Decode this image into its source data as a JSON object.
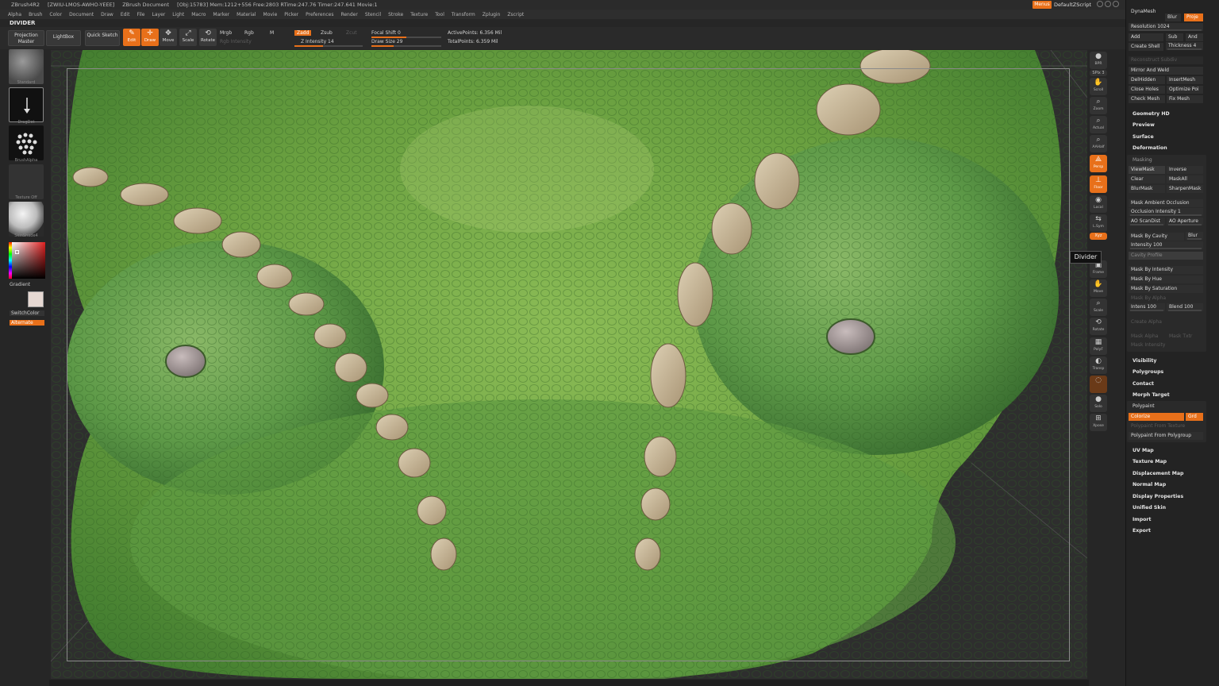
{
  "titlebar": {
    "app": "ZBrush4R2",
    "serial": "[ZWIU-LMOS-AWHO-YEEE]",
    "document": "ZBrush Document",
    "stats": "[Obj:15783] Mem:1212+556 Free:2803 RTime:247.76 Timer:247.641 Movie:1"
  },
  "menubar": {
    "items": [
      "Alpha",
      "Brush",
      "Color",
      "Document",
      "Draw",
      "Edit",
      "File",
      "Layer",
      "Light",
      "Macro",
      "Marker",
      "Material",
      "Movie",
      "Picker",
      "Preferences",
      "Render",
      "Stencil",
      "Stroke",
      "Texture",
      "Tool",
      "Transform",
      "Zplugin",
      "Zscript"
    ],
    "menus_label": "Menus",
    "script_label": "DefaultZScript"
  },
  "palette_title": "DIVIDER",
  "toolbar": {
    "projection_master": "Projection Master",
    "lightbox": "LightBox",
    "quick_sketch": "Quick Sketch",
    "edit": "Edit",
    "draw": "Draw",
    "move": "Move",
    "scale": "Scale",
    "rotate": "Rotate",
    "mrgb": "Mrgb",
    "rgb": "Rgb",
    "m": "M",
    "rgb_intensity": "Rgb Intensity",
    "zadd": "Zadd",
    "zsub": "Zsub",
    "zcut": "Zcut",
    "z_intensity": "Z Intensity 14",
    "focal_shift": "Focal Shift 0",
    "draw_size": "Draw Size 29",
    "active_points": "ActivePoints: 6.356 Mil",
    "total_points": "TotalPoints: 6.359 Mil",
    "focal_shift_value": 0.5,
    "draw_size_value": 0.32,
    "z_intensity_value": 0.14
  },
  "leftshelf": {
    "brush": "Standard",
    "stroke": "DragDot",
    "alpha": "BrushAlpha",
    "texture": "Texture Off",
    "material": "SkinShade4",
    "gradient": "Gradient",
    "switchcolor": "SwitchColor",
    "alternate": "Alternate"
  },
  "rightshelf": {
    "items": [
      "BPR",
      "SPix",
      "Scroll",
      "Zoom",
      "Actual",
      "AAHalf",
      "Persp",
      "Floor",
      "Local",
      "L.Sym",
      "Xyz",
      "",
      "Frame",
      "Move",
      "Scale",
      "Rotate",
      "PolyF",
      "Transp",
      "Ghost",
      "Solo",
      "Xpose"
    ],
    "spix_value": "3"
  },
  "tooltip": "Divider",
  "palette": {
    "dynamesh": "DynaMesh",
    "blur": "Blur",
    "project": "Proje",
    "resolution": "Resolution 1024",
    "add": "Add",
    "sub": "Sub",
    "and": "And",
    "create_shell": "Create Shell",
    "thickness": "Thickness 4",
    "reconstruct_subdiv": "Reconstruct Subdiv",
    "mirror_and_weld": "Mirror And Weld",
    "delhidden": "DelHidden",
    "inserthmesh": "InsertMesh",
    "close_holes": "Close Holes",
    "optimize_points": "Optimize Poi",
    "check_mesh": "Check Mesh",
    "fix_mesh": "Fix Mesh",
    "geometry_hd": "Geometry HD",
    "preview": "Preview",
    "surface": "Surface",
    "deformation": "Deformation",
    "masking": "Masking",
    "viewmask": "ViewMask",
    "inverse": "Inverse",
    "clear": "Clear",
    "maskall": "MaskAll",
    "blurmask": "BlurMask",
    "sharpenmask": "SharpenMask",
    "mask_ambient_occlusion": "Mask Ambient Occlusion",
    "occlusion_intensity": "Occlusion Intensity 1",
    "ao_scandist": "AO ScanDist",
    "ao_aperture": "AO Aperture",
    "mask_by_cavity": "Mask By Cavity",
    "cavity_blur": "Blur",
    "intensity": "Intensity 100",
    "cavity_profile": "Cavity Profile",
    "mask_by_intensity": "Mask By Intensity",
    "mask_by_hue": "Mask By Hue",
    "mask_by_saturation": "Mask By Saturation",
    "mask_by_alpha": "Mask By Alpha",
    "intens": "Intens 100",
    "blend": "Blend 100",
    "create_alpha": "Create Alpha",
    "mask_alpha": "Mask Alpha",
    "mask_tex": "Mask Txtr",
    "mask_intensity": "Mask Intensity",
    "visibility": "Visibility",
    "polygroups": "Polygroups",
    "contact": "Contact",
    "morph_target": "Morph Target",
    "polypaint": "Polypaint",
    "colorize": "Colorize",
    "grd": "Grd",
    "polypaint_from_texture": "Polypaint From Texture",
    "polypaint_from_polygroups": "Polypaint From Polygroup",
    "uv_map": "UV Map",
    "texture_map": "Texture Map",
    "displacement_map": "Displacement Map",
    "normal_map": "Normal Map",
    "display_properties": "Display Properties",
    "unified_skin": "Unified Skin",
    "import": "Import",
    "export": "Export"
  },
  "colors": {
    "accent": "#e8701a",
    "skin_base": "#5f9c3c",
    "skin_light": "#8fc05a",
    "scale_plate": "#c8b89a",
    "eye": "#9a8f8f"
  }
}
